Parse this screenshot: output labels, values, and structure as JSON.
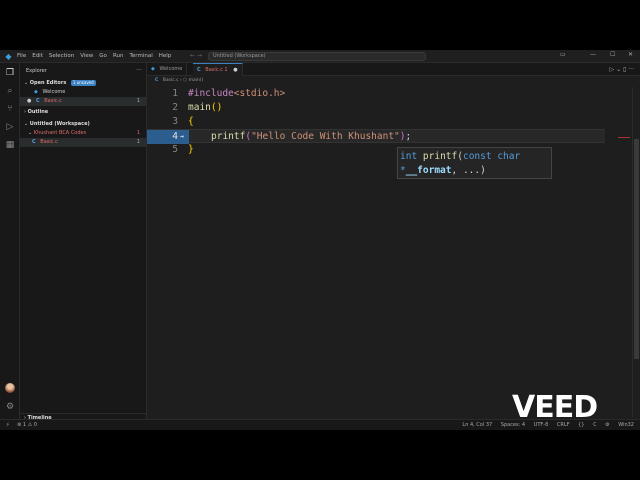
{
  "menu": [
    "File",
    "Edit",
    "Selection",
    "View",
    "Go",
    "Run",
    "Terminal",
    "Help"
  ],
  "command_center": "Untitled (Workspace)",
  "sidebar": {
    "title": "Explorer",
    "open_editors": {
      "label": "Open Editors",
      "badge": "1 unsaved",
      "items": [
        {
          "label": "Welcome"
        },
        {
          "label": "Basic.c",
          "count": "1"
        }
      ]
    },
    "outline": "Outline",
    "workspace": {
      "label": "Untitled (Workspace)",
      "folder": "Khushant BCA Codes",
      "folder_count": "1",
      "file": "Basic.c",
      "file_count": "1"
    },
    "timeline": "Timeline"
  },
  "tabs": [
    {
      "label": "Welcome"
    },
    {
      "label": "Basic.c 1"
    }
  ],
  "breadcrumb": {
    "file": "Basic.c",
    "symbol": "main()"
  },
  "code": {
    "lines": [
      {
        "num": "1",
        "a": "#include",
        "b": "<stdio.h>"
      },
      {
        "num": "2",
        "fn": "main",
        "rest": "()"
      },
      {
        "num": "3",
        "brace": "{"
      },
      {
        "num": "4",
        "fn": "printf",
        "open": "(",
        "str": "\"Hello Code With Khushant\"",
        "close": ")",
        "semi": ";"
      },
      {
        "num": "5",
        "brace": "}"
      }
    ]
  },
  "hover": {
    "t1": "int",
    "t2": "printf",
    "t3": "(",
    "t4": "const",
    "t5": "char",
    "t6": "*",
    "t7": "__format",
    "t8": ", ...)"
  },
  "status": {
    "errors": "1",
    "warnings": "0",
    "position": "Ln 4, Col 37",
    "spaces": "Spaces: 4",
    "encoding": "UTF-8",
    "eol": "CRLF",
    "language": "C",
    "platform": "Win32"
  },
  "watermark": "VEED",
  "colors": {
    "accent": "#3b82c4",
    "modified_tab": "#e06c6c"
  }
}
